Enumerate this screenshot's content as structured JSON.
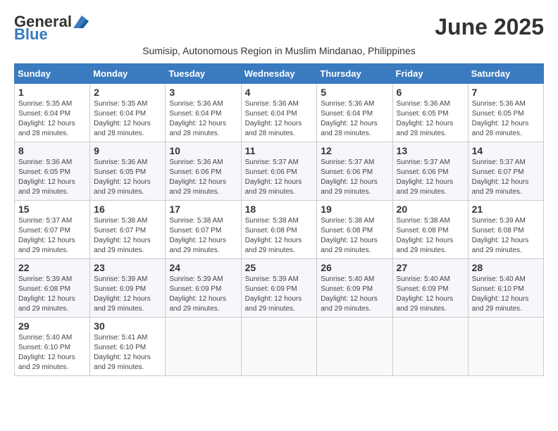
{
  "logo": {
    "general": "General",
    "blue": "Blue"
  },
  "title": "June 2025",
  "subtitle": "Sumisip, Autonomous Region in Muslim Mindanao, Philippines",
  "weekdays": [
    "Sunday",
    "Monday",
    "Tuesday",
    "Wednesday",
    "Thursday",
    "Friday",
    "Saturday"
  ],
  "weeks": [
    [
      {
        "day": "1",
        "sunrise": "5:35 AM",
        "sunset": "6:04 PM",
        "daylight": "12 hours and 28 minutes."
      },
      {
        "day": "2",
        "sunrise": "5:35 AM",
        "sunset": "6:04 PM",
        "daylight": "12 hours and 28 minutes."
      },
      {
        "day": "3",
        "sunrise": "5:36 AM",
        "sunset": "6:04 PM",
        "daylight": "12 hours and 28 minutes."
      },
      {
        "day": "4",
        "sunrise": "5:36 AM",
        "sunset": "6:04 PM",
        "daylight": "12 hours and 28 minutes."
      },
      {
        "day": "5",
        "sunrise": "5:36 AM",
        "sunset": "6:04 PM",
        "daylight": "12 hours and 28 minutes."
      },
      {
        "day": "6",
        "sunrise": "5:36 AM",
        "sunset": "6:05 PM",
        "daylight": "12 hours and 28 minutes."
      },
      {
        "day": "7",
        "sunrise": "5:36 AM",
        "sunset": "6:05 PM",
        "daylight": "12 hours and 28 minutes."
      }
    ],
    [
      {
        "day": "8",
        "sunrise": "5:36 AM",
        "sunset": "6:05 PM",
        "daylight": "12 hours and 29 minutes."
      },
      {
        "day": "9",
        "sunrise": "5:36 AM",
        "sunset": "6:05 PM",
        "daylight": "12 hours and 29 minutes."
      },
      {
        "day": "10",
        "sunrise": "5:36 AM",
        "sunset": "6:06 PM",
        "daylight": "12 hours and 29 minutes."
      },
      {
        "day": "11",
        "sunrise": "5:37 AM",
        "sunset": "6:06 PM",
        "daylight": "12 hours and 29 minutes."
      },
      {
        "day": "12",
        "sunrise": "5:37 AM",
        "sunset": "6:06 PM",
        "daylight": "12 hours and 29 minutes."
      },
      {
        "day": "13",
        "sunrise": "5:37 AM",
        "sunset": "6:06 PM",
        "daylight": "12 hours and 29 minutes."
      },
      {
        "day": "14",
        "sunrise": "5:37 AM",
        "sunset": "6:07 PM",
        "daylight": "12 hours and 29 minutes."
      }
    ],
    [
      {
        "day": "15",
        "sunrise": "5:37 AM",
        "sunset": "6:07 PM",
        "daylight": "12 hours and 29 minutes."
      },
      {
        "day": "16",
        "sunrise": "5:38 AM",
        "sunset": "6:07 PM",
        "daylight": "12 hours and 29 minutes."
      },
      {
        "day": "17",
        "sunrise": "5:38 AM",
        "sunset": "6:07 PM",
        "daylight": "12 hours and 29 minutes."
      },
      {
        "day": "18",
        "sunrise": "5:38 AM",
        "sunset": "6:08 PM",
        "daylight": "12 hours and 29 minutes."
      },
      {
        "day": "19",
        "sunrise": "5:38 AM",
        "sunset": "6:08 PM",
        "daylight": "12 hours and 29 minutes."
      },
      {
        "day": "20",
        "sunrise": "5:38 AM",
        "sunset": "6:08 PM",
        "daylight": "12 hours and 29 minutes."
      },
      {
        "day": "21",
        "sunrise": "5:39 AM",
        "sunset": "6:08 PM",
        "daylight": "12 hours and 29 minutes."
      }
    ],
    [
      {
        "day": "22",
        "sunrise": "5:39 AM",
        "sunset": "6:08 PM",
        "daylight": "12 hours and 29 minutes."
      },
      {
        "day": "23",
        "sunrise": "5:39 AM",
        "sunset": "6:09 PM",
        "daylight": "12 hours and 29 minutes."
      },
      {
        "day": "24",
        "sunrise": "5:39 AM",
        "sunset": "6:09 PM",
        "daylight": "12 hours and 29 minutes."
      },
      {
        "day": "25",
        "sunrise": "5:39 AM",
        "sunset": "6:09 PM",
        "daylight": "12 hours and 29 minutes."
      },
      {
        "day": "26",
        "sunrise": "5:40 AM",
        "sunset": "6:09 PM",
        "daylight": "12 hours and 29 minutes."
      },
      {
        "day": "27",
        "sunrise": "5:40 AM",
        "sunset": "6:09 PM",
        "daylight": "12 hours and 29 minutes."
      },
      {
        "day": "28",
        "sunrise": "5:40 AM",
        "sunset": "6:10 PM",
        "daylight": "12 hours and 29 minutes."
      }
    ],
    [
      {
        "day": "29",
        "sunrise": "5:40 AM",
        "sunset": "6:10 PM",
        "daylight": "12 hours and 29 minutes."
      },
      {
        "day": "30",
        "sunrise": "5:41 AM",
        "sunset": "6:10 PM",
        "daylight": "12 hours and 29 minutes."
      },
      null,
      null,
      null,
      null,
      null
    ]
  ]
}
